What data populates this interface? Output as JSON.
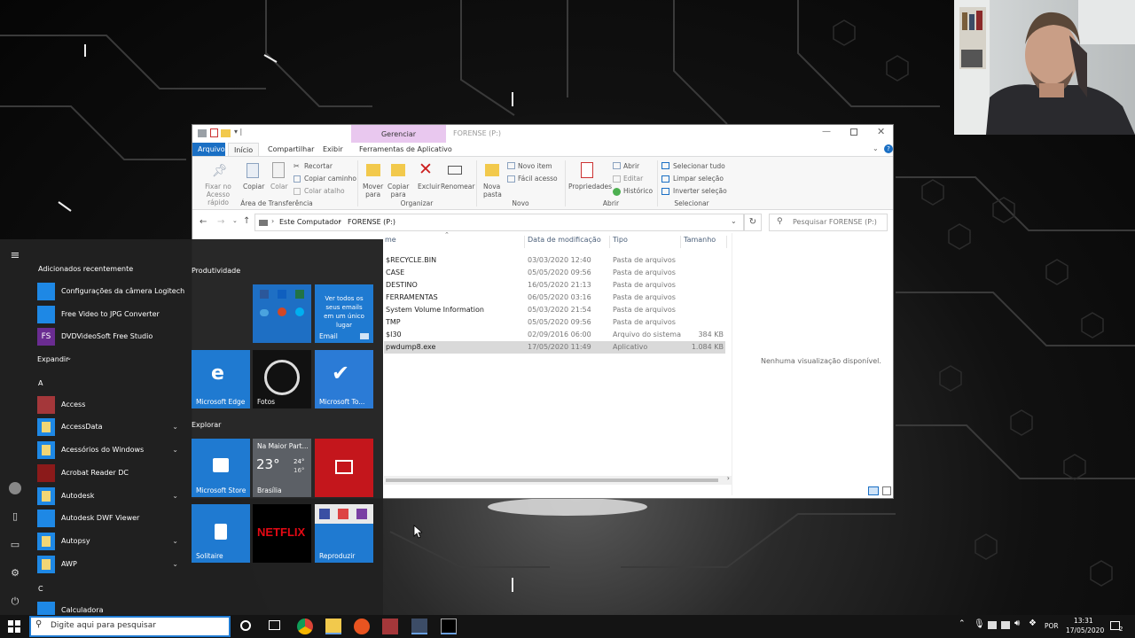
{
  "explorer": {
    "title": "FORENSE (P:)",
    "manage_tab": "Gerenciar",
    "app_tools_tab": "Ferramentas de Aplicativo",
    "tabs": [
      "Arquivo",
      "Início",
      "Compartilhar",
      "Exibir"
    ],
    "ribbon": {
      "clipboard": {
        "pin": "Fixar no\nAcesso rápido",
        "copy": "Copiar",
        "paste": "Colar",
        "cut": "Recortar",
        "copy_path": "Copiar caminho",
        "paste_shortcut": "Colar atalho",
        "caption": "Área de Transferência"
      },
      "organize": {
        "move": "Mover\npara",
        "copy_to": "Copiar\npara",
        "delete": "Excluir",
        "rename": "Renomear",
        "caption": "Organizar"
      },
      "new": {
        "new_folder": "Nova\npasta",
        "new_item": "Novo item",
        "easy_access": "Fácil acesso",
        "caption": "Novo"
      },
      "open": {
        "properties": "Propriedades",
        "open": "Abrir",
        "edit": "Editar",
        "history": "Histórico",
        "caption": "Abrir"
      },
      "select": {
        "select_all": "Selecionar tudo",
        "clear": "Limpar seleção",
        "invert": "Inverter seleção",
        "caption": "Selecionar"
      }
    },
    "breadcrumb": [
      "Este Computador",
      "FORENSE (P:)"
    ],
    "search_placeholder": "Pesquisar FORENSE (P:)",
    "columns": {
      "name": "me",
      "date": "Data de modificação",
      "type": "Tipo",
      "size": "Tamanho"
    },
    "files": [
      {
        "name": "$RECYCLE.BIN",
        "date": "03/03/2020 12:40",
        "type": "Pasta de arquivos",
        "size": ""
      },
      {
        "name": "CASE",
        "date": "05/05/2020 09:56",
        "type": "Pasta de arquivos",
        "size": ""
      },
      {
        "name": "DESTINO",
        "date": "16/05/2020 21:13",
        "type": "Pasta de arquivos",
        "size": ""
      },
      {
        "name": "FERRAMENTAS",
        "date": "06/05/2020 03:16",
        "type": "Pasta de arquivos",
        "size": ""
      },
      {
        "name": "System Volume Information",
        "date": "05/03/2020 21:54",
        "type": "Pasta de arquivos",
        "size": ""
      },
      {
        "name": "TMP",
        "date": "05/05/2020 09:56",
        "type": "Pasta de arquivos",
        "size": ""
      },
      {
        "name": "$I30",
        "date": "02/09/2016 06:00",
        "type": "Arquivo do sistema",
        "size": "384 KB"
      },
      {
        "name": "pwdump8.exe",
        "date": "17/05/2020 11:49",
        "type": "Aplicativo",
        "size": "1.084 KB"
      }
    ],
    "preview_text": "Nenhuma visualização disponível."
  },
  "start": {
    "recent_header": "Adicionados recentemente",
    "recent": [
      "Configurações da câmera Logitech",
      "Free Video to JPG Converter",
      "DVDVideoSoft Free Studio"
    ],
    "expand": "Expandir",
    "letter_a": "A",
    "apps_a": [
      "Access",
      "AccessData",
      "Acessórios do Windows",
      "Acrobat Reader DC",
      "Autodesk",
      "Autodesk DWF Viewer",
      "Autopsy",
      "AWP"
    ],
    "letter_c": "C",
    "apps_c": [
      "Calculadora"
    ],
    "group_productivity": "Produtividade",
    "group_explore": "Explorar",
    "tiles": {
      "mail_text": "Ver todos os seus emails em um único lugar",
      "mail": "Email",
      "edge": "Microsoft Edge",
      "photos": "Fotos",
      "todo": "Microsoft To...",
      "store": "Microsoft Store",
      "weather_city_line": "Na Maior Part...",
      "weather_temp": "23°",
      "weather_hi": "24°",
      "weather_lo": "16°",
      "weather_city": "Brasília",
      "solitaire": "Solitaire",
      "netflix": "NETFLIX",
      "play": "Reproduzir"
    },
    "fs_badge": "FS"
  },
  "taskbar": {
    "search_placeholder": "Digite aqui para pesquisar",
    "lang": "POR",
    "time": "13:31",
    "date": "17/05/2020",
    "notif_count": "2"
  }
}
